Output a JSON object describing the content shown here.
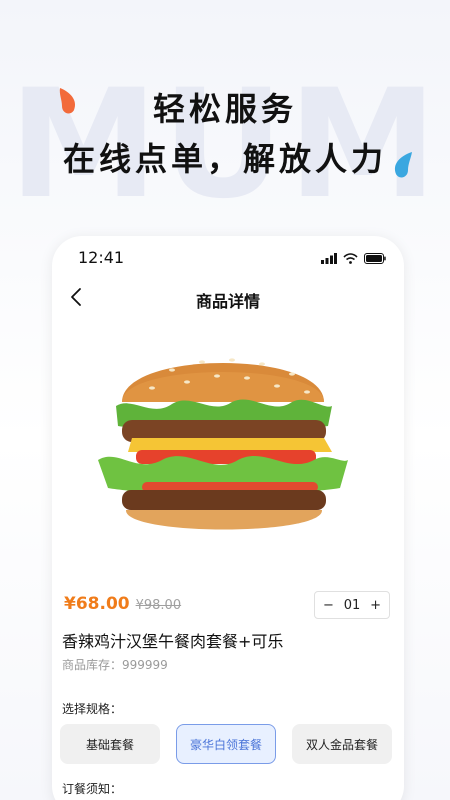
{
  "background": {
    "watermark": "MUM"
  },
  "hero": {
    "line1": "轻松服务",
    "line2": "在线点单，解放人力"
  },
  "status_bar": {
    "time": "12:41"
  },
  "nav": {
    "title": "商品详情"
  },
  "product": {
    "price": "¥68.00",
    "original_price": "¥98.00",
    "quantity": "01",
    "minus": "−",
    "plus": "+",
    "name": "香辣鸡汁汉堡午餐肉套餐+可乐",
    "stock": "商品库存：999999"
  },
  "spec": {
    "label": "选择规格：",
    "options": [
      "基础套餐",
      "豪华白领套餐",
      "双人金品套餐"
    ],
    "selected_index": 1
  },
  "notice": {
    "label": "订餐须知："
  },
  "colors": {
    "accent_price": "#f07c1a",
    "selected_blue": "#4a74d8"
  }
}
